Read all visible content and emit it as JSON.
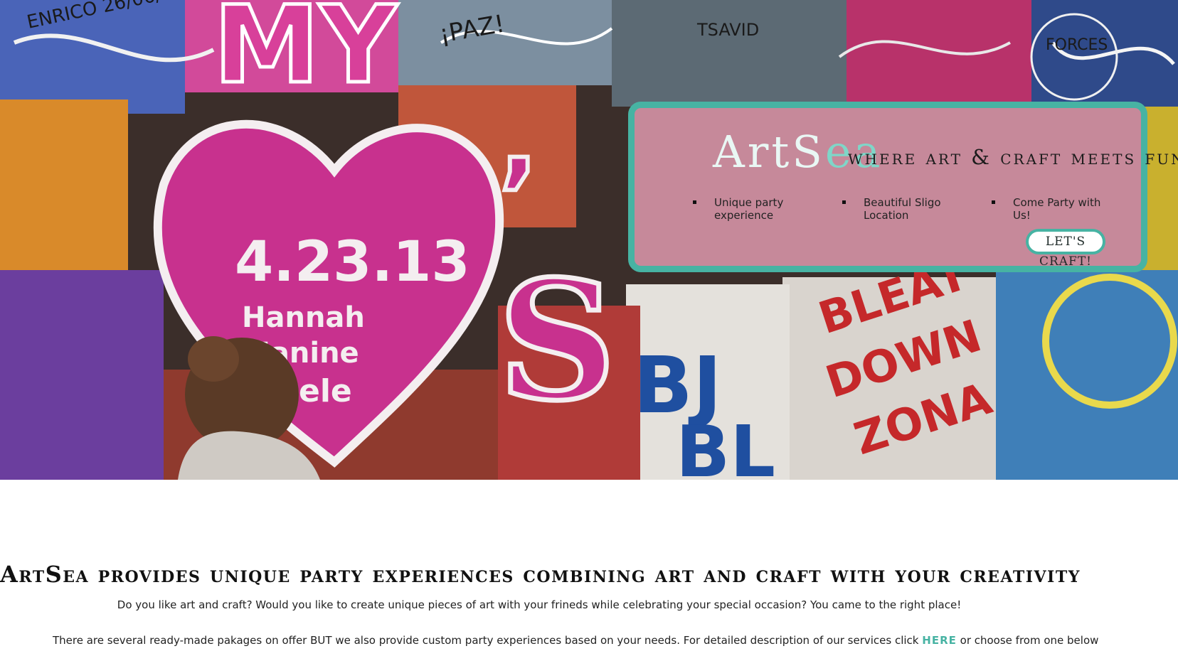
{
  "hero": {
    "brand": {
      "art": "ArtS",
      "sea": "ea"
    },
    "tagline": "where art & craft meets fun",
    "features": [
      "Unique party experience",
      "Beautiful Sligo Location",
      "Come Party with Us!"
    ],
    "cta_label": "LET'S CRAFT!",
    "colors": {
      "card": "#c6899a",
      "border": "#47b3a3",
      "brand": "#e9f7f4",
      "accent": "#7fd6c8"
    }
  },
  "main": {
    "heading": "ArtSea provides unique party experiences combining art and craft with your creativity",
    "intro": "Do you like art and craft? Would you like to create unique pieces of art with your frineds while celebrating your special occasion? You came to the right place!",
    "packages_before": "There are several ready-made pakages on offer BUT we also provide custom party experiences based on your needs. For detailed description of our services click ",
    "packages_link": "HERE",
    "packages_after": " or choose from one below"
  }
}
